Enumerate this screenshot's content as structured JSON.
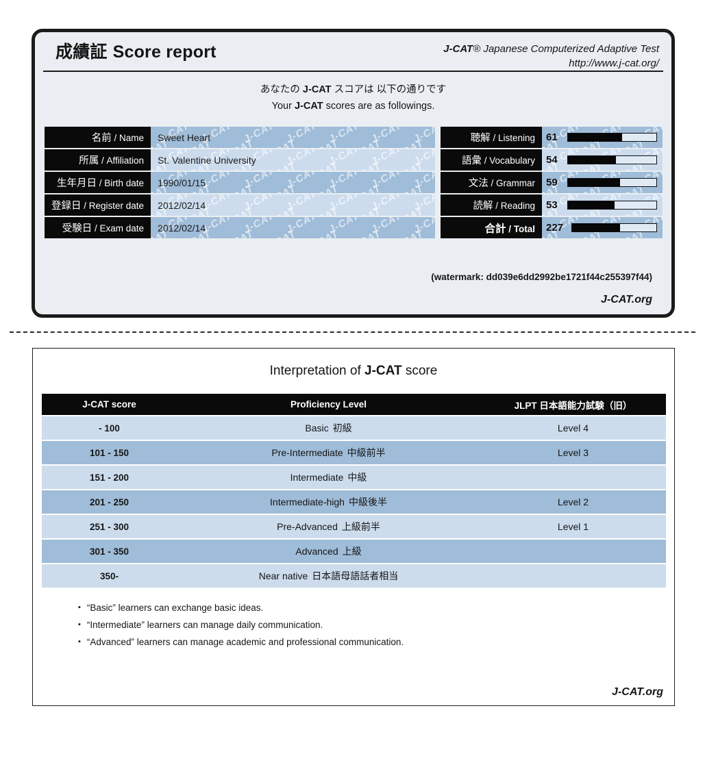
{
  "report": {
    "title_jp": "成績証",
    "title_en": "Score report",
    "brand": "J-CAT",
    "brand_suffix": "® Japanese Computerized Adaptive Test",
    "url": "http://www.j-cat.org/",
    "subtitle_jp_before": "あなたの ",
    "subtitle_jp_after": " スコアは 以下の通りです",
    "subtitle_en_before": "Your ",
    "subtitle_en_after": " scores are as followings.",
    "watermark_note": "(watermark: dd039e6dd2992be1721f44c255397f44)",
    "footer": "J-CAT.org",
    "watermark_tile_text": "J-CAT",
    "info_rows": [
      {
        "label_jp": "名前",
        "label_en": "Name",
        "value": "Sweet Heart"
      },
      {
        "label_jp": "所属",
        "label_en": "Affiliation",
        "value": "St. Valentine University"
      },
      {
        "label_jp": "生年月日",
        "label_en": "Birth date",
        "value": "1990/01/15"
      },
      {
        "label_jp": "登録日",
        "label_en": "Register date",
        "value": "2012/02/14"
      },
      {
        "label_jp": "受験日",
        "label_en": "Exam date",
        "value": "2012/02/14"
      }
    ],
    "score_rows": [
      {
        "label_jp": "聴解",
        "label_en": "Listening",
        "score": "61",
        "fill_percent": 61
      },
      {
        "label_jp": "語彙",
        "label_en": "Vocabulary",
        "score": "54",
        "fill_percent": 54
      },
      {
        "label_jp": "文法",
        "label_en": "Grammar",
        "score": "59",
        "fill_percent": 59
      },
      {
        "label_jp": "読解",
        "label_en": "Reading",
        "score": "53",
        "fill_percent": 53
      },
      {
        "label_jp": "合計",
        "label_en": "Total",
        "score": "227",
        "fill_percent": 57
      }
    ]
  },
  "interpretation": {
    "title_before": "Interpretation of ",
    "title_brand": "J-CAT",
    "title_after": " score",
    "columns": [
      "J-CAT score",
      "Proficiency Level",
      "JLPT 日本語能力試験（旧）"
    ],
    "rows": [
      {
        "range": "- 100",
        "level_en": "Basic",
        "level_jp": "初級",
        "jlpt": "Level 4"
      },
      {
        "range": "101 - 150",
        "level_en": "Pre-Intermediate",
        "level_jp": "中級前半",
        "jlpt": "Level 3"
      },
      {
        "range": "151 - 200",
        "level_en": "Intermediate",
        "level_jp": "中級",
        "jlpt": ""
      },
      {
        "range": "201 - 250",
        "level_en": "Intermediate-high",
        "level_jp": "中級後半",
        "jlpt": "Level 2"
      },
      {
        "range": "251 - 300",
        "level_en": "Pre-Advanced",
        "level_jp": "上級前半",
        "jlpt": "Level 1"
      },
      {
        "range": "301 - 350",
        "level_en": "Advanced",
        "level_jp": "上級",
        "jlpt": ""
      },
      {
        "range": "350-",
        "level_en": "Near native",
        "level_jp": "日本語母語話者相当",
        "jlpt": ""
      }
    ],
    "notes": [
      "“Basic” learners can exchange basic ideas.",
      "“Intermediate” learners can manage daily communication.",
      "“Advanced” learners can manage academic and professional communication."
    ],
    "bullet_glyph": "▪",
    "footer": "J-CAT.org"
  },
  "colors": {
    "card_bg": "#eaeef2",
    "row_light": "#ccdced",
    "row_dark": "#9fbcd8",
    "label_bg": "#0a0a0a",
    "bar_fill": "#070707",
    "bar_track": "#dfeaf5"
  }
}
